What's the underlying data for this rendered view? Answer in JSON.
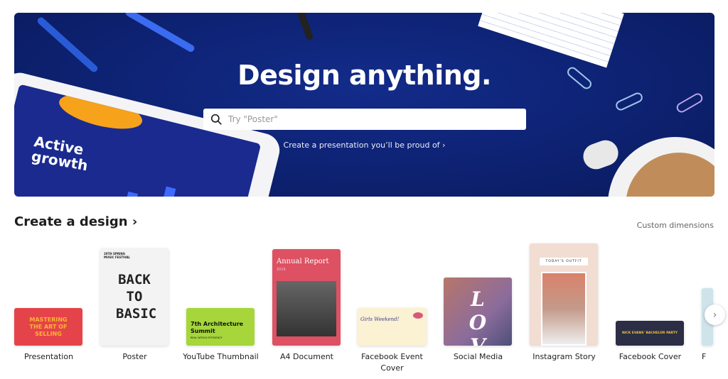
{
  "hero": {
    "title": "Design anything.",
    "search_placeholder": "Try \"Poster\"",
    "link": "Create a presentation you’ll be proud of ›",
    "tablet_text": "Active growth",
    "background_color": "#0d2170"
  },
  "section": {
    "title": "Create a design ›",
    "custom_dimensions": "Custom dimensions"
  },
  "designs": [
    {
      "label": "Presentation",
      "thumb_text": "MASTERING THE ART OF SELLING"
    },
    {
      "label": "Poster",
      "thumb_text": "BACK TO BASIC",
      "thumb_sub": "20TH SPRING MUSIC FESTIVAL"
    },
    {
      "label": "YouTube Thumbnail",
      "thumb_text": "7th Architecture Summit",
      "thumb_sub": "REAL WORLD EFFICIENCY"
    },
    {
      "label": "A4 Document",
      "thumb_text": "Annual Report",
      "thumb_sub": "2019"
    },
    {
      "label": "Facebook Event Cover",
      "thumb_text": "Girls Weekend!"
    },
    {
      "label": "Social Media",
      "thumb_text": "LOVE"
    },
    {
      "label": "Instagram Story",
      "thumb_text": "TODAY'S OUTFIT"
    },
    {
      "label": "Facebook Cover",
      "thumb_text": "NICK EVANS' BACHELOR PARTY"
    },
    {
      "label": "F"
    }
  ],
  "next_icon": "chevron-right-icon"
}
